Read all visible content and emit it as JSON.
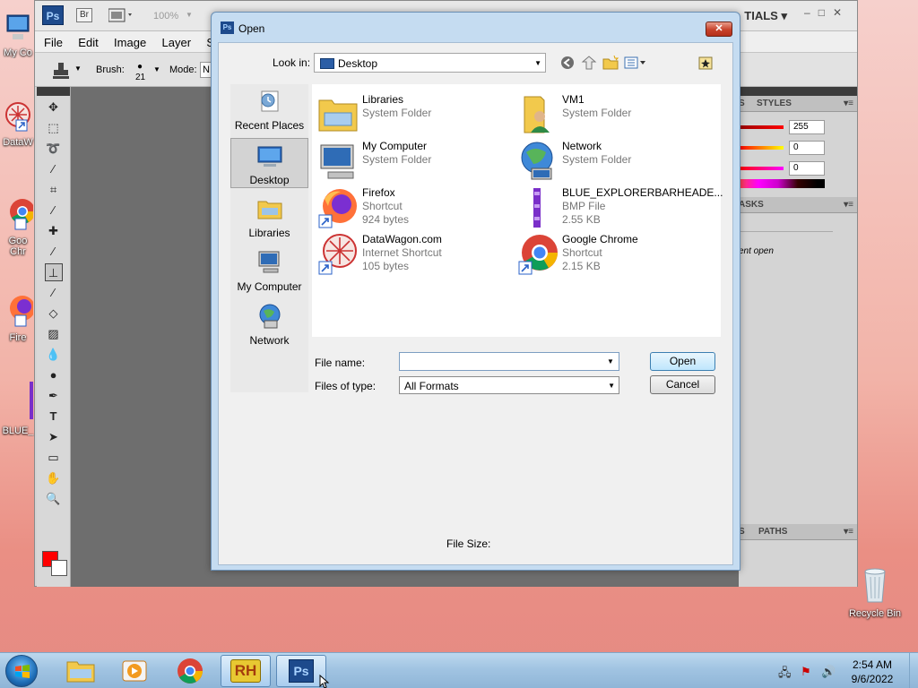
{
  "desktop": {
    "icons": [
      {
        "label": "My Co"
      },
      {
        "label": "DataW"
      },
      {
        "label": "Goo Chr"
      },
      {
        "label": "Fire"
      },
      {
        "label": "BLUE_"
      },
      {
        "label": "Recycle Bin"
      }
    ]
  },
  "photoshop": {
    "logo": "Ps",
    "bridge": "Br",
    "zoom": "100%",
    "workspace": "TIALS",
    "menu": [
      "File",
      "Edit",
      "Image",
      "Layer",
      "Sel"
    ],
    "options": {
      "brush_label": "Brush:",
      "brush_size": "21",
      "mode_label": "Mode:",
      "mode_value": "N"
    },
    "panels": {
      "tabs_top": [
        "S",
        "STYLES"
      ],
      "sliders": [
        "255",
        "0",
        "0"
      ],
      "tasks_tab": "ASKS",
      "recent_text": "ent open",
      "tabs_bottom": [
        "S",
        "PATHS"
      ]
    }
  },
  "dialog": {
    "title": "Open",
    "close_glyph": "✕",
    "look_in_label": "Look in:",
    "look_in_value": "Desktop",
    "places": [
      {
        "label": "Recent Places"
      },
      {
        "label": "Desktop"
      },
      {
        "label": "Libraries"
      },
      {
        "label": "My Computer"
      },
      {
        "label": "Network"
      }
    ],
    "files": [
      {
        "name": "Libraries",
        "line2": "System Folder",
        "line3": ""
      },
      {
        "name": "VM1",
        "line2": "System Folder",
        "line3": ""
      },
      {
        "name": "My Computer",
        "line2": "System Folder",
        "line3": ""
      },
      {
        "name": "Network",
        "line2": "System Folder",
        "line3": ""
      },
      {
        "name": "Firefox",
        "line2": "Shortcut",
        "line3": "924 bytes"
      },
      {
        "name": "BLUE_EXPLORERBARHEADE...",
        "line2": "BMP File",
        "line3": "2.55 KB"
      },
      {
        "name": "DataWagon.com",
        "line2": "Internet Shortcut",
        "line3": "105 bytes"
      },
      {
        "name": "Google Chrome",
        "line2": "Shortcut",
        "line3": "2.15 KB"
      }
    ],
    "file_name_label": "File name:",
    "file_name_value": "",
    "files_of_type_label": "Files of type:",
    "files_of_type_value": "All Formats",
    "open_button": "Open",
    "cancel_button": "Cancel",
    "file_size_label": "File Size:"
  },
  "taskbar": {
    "rh_label": "RH",
    "ps_label": "Ps",
    "time": "2:54 AM",
    "date": "9/6/2022"
  }
}
